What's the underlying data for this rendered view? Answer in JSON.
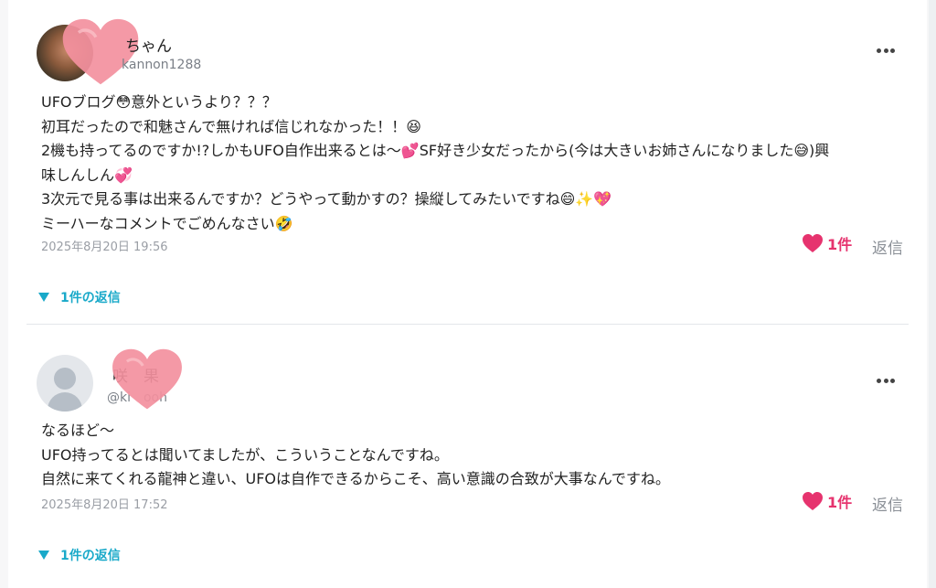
{
  "comments": [
    {
      "user_name": "ちゃん",
      "user_handle": "kannon1288",
      "body_lines": [
        "UFOブログ😳意外というより？？？",
        "初耳だったので和魅さんで無ければ信じれなかった！！😆",
        "2機も持ってるのですか!?しかもUFO自作出来るとは〜💕SF好き少女だったから(今は大きいお姉さんになりました😅)興",
        "味しんしん💞",
        "3次元で見る事は出来るんですか？どうやって動かすの？操縦してみたいですね😄✨💖",
        "ミーハーなコメントでごめんなさい🤣"
      ],
      "timestamp": "2025年8月20日 19:56",
      "like_count": "1件",
      "reply_label": "返信",
      "replies_toggle": "1件の返信"
    },
    {
      "user_name": "咲　果",
      "user_handle": "@ki　ooh",
      "body_lines": [
        "なるほど〜",
        "UFO持ってるとは聞いてましたが、こういうことなんですね。",
        "自然に来てくれる龍神と違い、UFOは自作できるからこそ、高い意識の合致が大事なんですね。"
      ],
      "timestamp": "2025年8月20日 17:52",
      "like_count": "1件",
      "reply_label": "返信",
      "replies_toggle": "1件の返信"
    }
  ],
  "colors": {
    "accent": "#19a9c9",
    "like": "#e6336e",
    "divider": "#e3e6ea"
  },
  "icons": {
    "more": "more-horizontal-icon",
    "like": "heart-icon",
    "toggle": "triangle-down-icon",
    "sticker": "heart-sticker-icon",
    "avatar_default": "user-silhouette-icon"
  }
}
